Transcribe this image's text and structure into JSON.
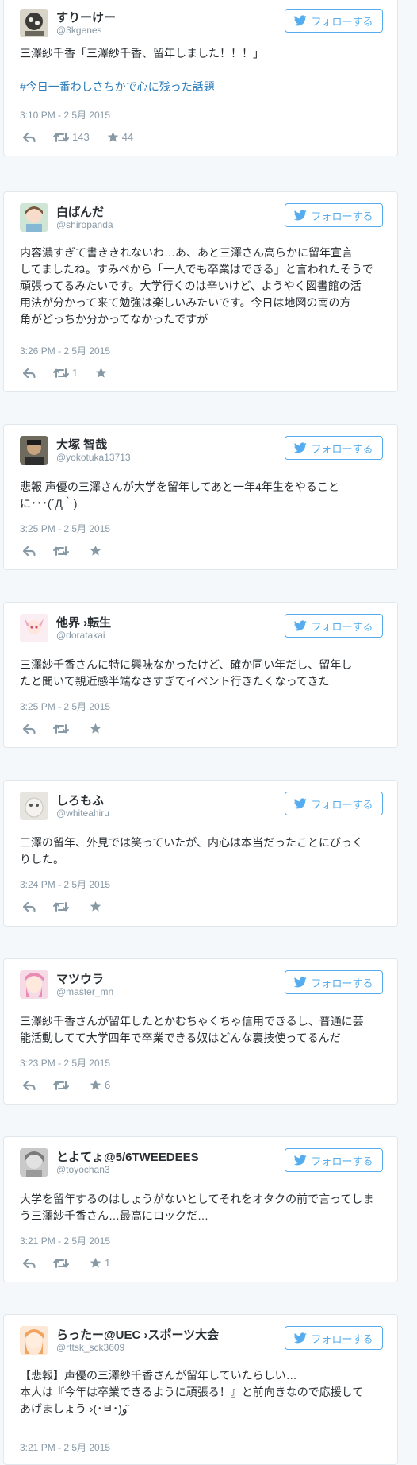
{
  "follow_label": "フォローする",
  "colors": {
    "accent": "#55acee",
    "link": "#2b7bb9",
    "meta": "#8899a6"
  },
  "tweets": [
    {
      "name": "すりーけー",
      "handle": "@3kgenes",
      "lines": [
        "三澤紗千香「三澤紗千香、留年しました！！！」",
        "",
        "#今日一番わしさちかで心に残った話題"
      ],
      "time": "3:10 PM - 2 5月 2015",
      "retweets": "143",
      "favorites": "44"
    },
    {
      "name": "白ぱんだ",
      "handle": "@shiropanda",
      "lines": [
        "内容濃すぎて書ききれないわ…あ、あと三澤さん高らかに留年宣言",
        "してましたね。すみぺから「一人でも卒業はできる」と言われたそうで",
        "頑張ってるみたいです。大学行くのは辛いけど、ようやく図書館の活",
        "用法が分かって来て勉強は楽しいみたいです。今日は地図の南の方",
        "角がどっちか分かってなかったですが"
      ],
      "time": "3:26 PM - 2 5月 2015",
      "retweets": "1",
      "favorites": ""
    },
    {
      "name": "大塚 智哉",
      "handle": "@yokotuka13713",
      "lines": [
        "悲報 声優の三澤さんが大学を留年してあと一年4年生をやること",
        "に･･･(´Д｀)"
      ],
      "time": "3:25 PM - 2 5月 2015",
      "retweets": "",
      "favorites": ""
    },
    {
      "name": "他界 ›転生",
      "handle": "@doratakai",
      "lines": [
        "三澤紗千香さんに特に興味なかったけど、確か同い年だし、留年し",
        "たと聞いて親近感半端なさすぎてイベント行きたくなってきた"
      ],
      "time": "3:25 PM - 2 5月 2015",
      "retweets": "",
      "favorites": ""
    },
    {
      "name": "しろもふ",
      "handle": "@whiteahiru",
      "lines": [
        "三澤の留年、外見では笑っていたが、内心は本当だったことにびっく",
        "りした。"
      ],
      "time": "3:24 PM - 2 5月 2015",
      "retweets": "",
      "favorites": ""
    },
    {
      "name": "マツウラ",
      "handle": "@master_mn",
      "lines": [
        "三澤紗千香さんが留年したとかむちゃくちゃ信用できるし、普通に芸",
        "能活動してて大学四年で卒業できる奴はどんな裏技使ってるんだ"
      ],
      "time": "3:23 PM - 2 5月 2015",
      "retweets": "",
      "favorites": "6"
    },
    {
      "name": "とよてょ@5/6TWEEDEES",
      "handle": "@toyochan3",
      "lines": [
        "大学を留年するのはしょうがないとしてそれをオタクの前で言ってしま",
        "う三澤紗千香さん…最高にロックだ…"
      ],
      "time": "3:21 PM - 2 5月 2015",
      "retweets": "",
      "favorites": "1"
    },
    {
      "name": "らったー@UEC ›スポーツ大会",
      "handle": "@rttsk_sck3609",
      "lines": [
        "【悲報】声優の三澤紗千香さんが留年していたらしい…",
        "本人は『今年は卒業できるように頑張る！』と前向きなので応援して",
        "あげましょう ›(･ㅂ･)و ̑̑"
      ],
      "time": "3:21 PM - 2 5月 2015",
      "retweets": "",
      "favorites": ""
    }
  ]
}
